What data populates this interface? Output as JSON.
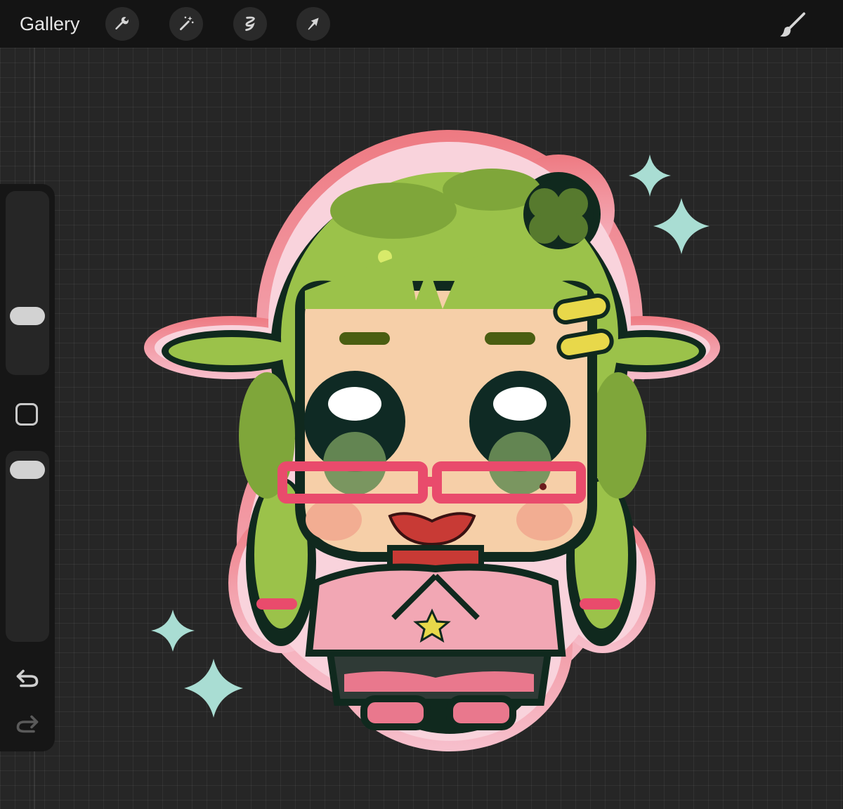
{
  "toolbar": {
    "gallery_label": "Gallery",
    "icons": [
      "wrench-icon",
      "magic-wand-icon",
      "selection-icon",
      "transform-arrow-icon",
      "paintbrush-icon"
    ]
  },
  "sidebar": {
    "controls": [
      "brush-size-slider",
      "modify-button",
      "opacity-slider",
      "undo-icon",
      "redo-icon"
    ],
    "brush_size_level": 0.72,
    "opacity_level": 0.11
  },
  "colors": {
    "toolbar_bg": "#141414",
    "canvas_bg": "#262626",
    "hair": "#9bc24a",
    "outline": "#10291e",
    "skin": "#f6cfa8",
    "sticker_border_top": "#ee7a82",
    "sticker_border_bottom": "#f7c0cd",
    "glasses": "#e94b6c",
    "sparkle": "#a9ddd3",
    "hair_clip": "#e8d84a"
  }
}
